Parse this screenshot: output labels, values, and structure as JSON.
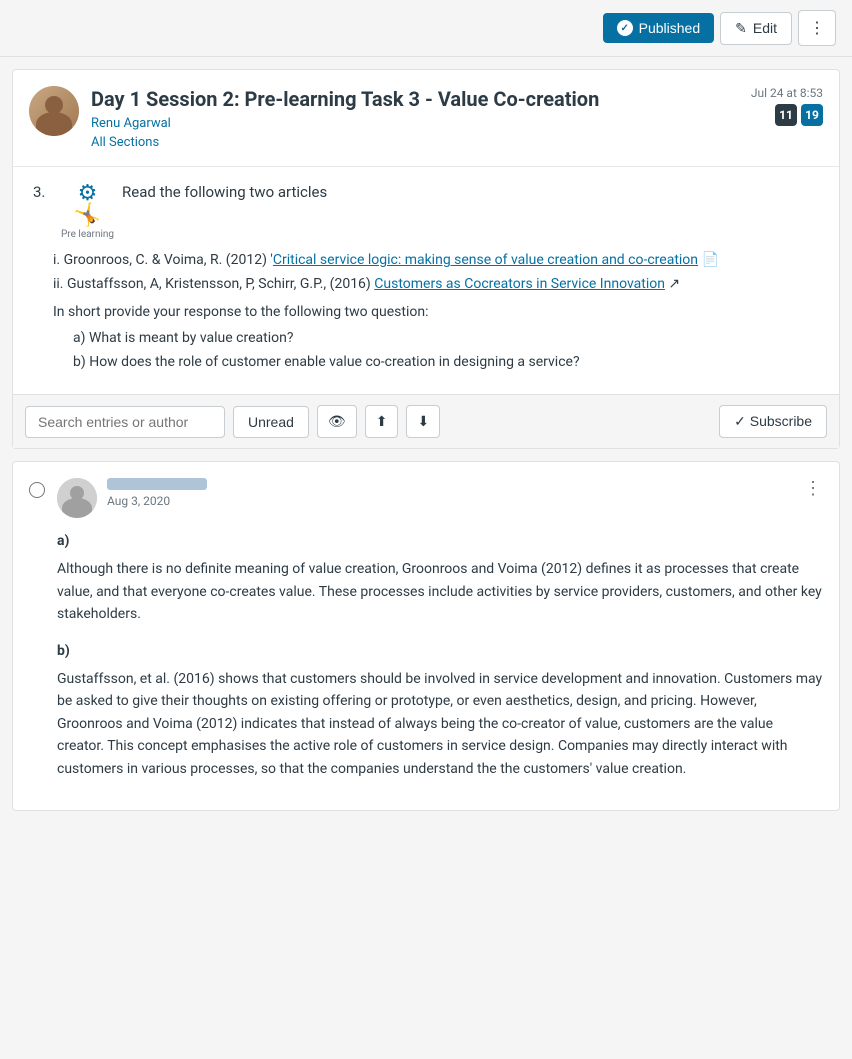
{
  "topbar": {
    "published_label": "Published",
    "edit_label": "Edit",
    "more_label": "⋮"
  },
  "discussion": {
    "title": "Day 1 Session 2: Pre-learning Task 3 - Value Co-creation",
    "author": "Renu Agarwal",
    "all_sections": "All Sections",
    "date": "Jul 24 at 8:53",
    "badge_unread": "11",
    "badge_total": "19",
    "task_number": "3.",
    "task_text": "Read the following  two articles",
    "icon_label": "Pre learning",
    "article1_prefix": "i. Groonroos, C. & Voima, R. (2012) '",
    "article1_link": "Critical service logic: making sense of value creation and co-creation",
    "article1_suffix": "' 📄",
    "article2_prefix": "ii.  Gustaffsson, A, Kristensson, P, Schirr, G.P., (2016) ",
    "article2_link": "Customers as Cocreators in Service Innovation",
    "article2_suffix": " ↗",
    "questions_intro": "In short provide your response to the following two  question:",
    "question_a": "a) What is meant by value creation?",
    "question_b": "b) How does the role of  customer enable value co-creation in designing a service?"
  },
  "toolbar": {
    "search_placeholder": "Search entries or author",
    "unread_label": "Unread",
    "subscribe_label": "✓ Subscribe"
  },
  "reply": {
    "date": "Aug 3, 2020",
    "section_a_label": "a)",
    "section_a_text": "Although there is no definite meaning of value creation, Groonroos and Voima (2012) defines it as processes that create value, and that everyone co-creates value. These processes include activities by service providers, customers, and other key stakeholders.",
    "section_b_label": "b)",
    "section_b_text": "Gustaffsson, et al. (2016) shows that customers should be involved in service development and innovation. Customers may be asked to give their thoughts on existing offering or prototype, or even aesthetics, design, and pricing. However, Groonroos and Voima (2012) indicates that instead of always being the co-creator of value, customers are the value creator. This concept emphasises the active role of customers in service design. Companies may directly interact with customers in various processes, so that the companies understand the the customers' value creation."
  }
}
